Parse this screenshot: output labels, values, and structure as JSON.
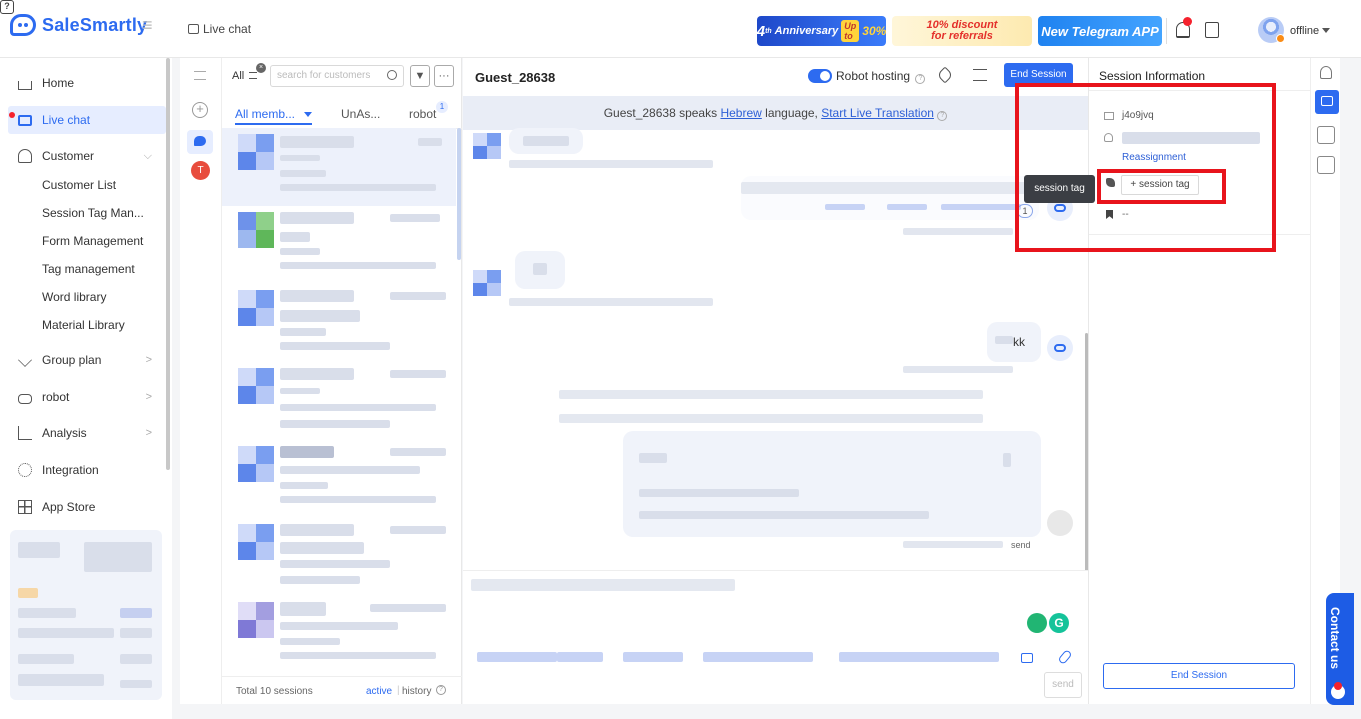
{
  "brand": {
    "name": "SaleSmartly"
  },
  "topbar": {
    "title": "Live chat",
    "anniversary": {
      "prefix": "4",
      "suffix": "th",
      "label": "Anniversary",
      "chip": "Up to",
      "percent": "30%"
    },
    "discount": {
      "line1": "10% discount",
      "line2": "for referrals"
    },
    "telegram": "New Telegram APP",
    "status": "offline"
  },
  "sidebar": {
    "home": "Home",
    "live_chat": "Live chat",
    "customer": "Customer",
    "customer_sub": [
      "Customer List",
      "Session Tag Man...",
      "Form Management",
      "Tag management",
      "Word library",
      "Material Library"
    ],
    "group_plan": "Group plan",
    "robot": "robot",
    "analysis": "Analysis",
    "integration": "Integration",
    "app_store": "App Store"
  },
  "strip": {
    "avatar_letter": "T"
  },
  "session_list": {
    "all_label": "All",
    "search_placeholder": "search for customers",
    "filter_icon": "funnel-icon",
    "more_label": "···",
    "tabs": [
      "All memb...",
      "UnAs...",
      "robot"
    ],
    "robot_count": "1",
    "total": "Total 10 sessions",
    "active": "active",
    "history": "history"
  },
  "chat": {
    "guest_name": "Guest_28638",
    "robot_hosting": "Robot hosting",
    "end_session": "End Session",
    "translate": {
      "speaker": "Guest_28638 speaks",
      "language": "Hebrew",
      "mid": "language,",
      "link": "Start Live Translation"
    },
    "message_kk": "kk",
    "read_count": "1",
    "send_status": "send",
    "send_button": "send"
  },
  "session_info": {
    "title": "Session Information",
    "code": "j4o9jvq",
    "reassignment": "Reassignment",
    "add_tag": "+ session tag",
    "tooltip": "session tag",
    "dash": "--",
    "end_session": "End Session"
  },
  "contact": {
    "label": "Contact us"
  },
  "colors": {
    "accent": "#2d6bf0",
    "highlight": "#e8141c",
    "active_bg": "#e6edff"
  }
}
